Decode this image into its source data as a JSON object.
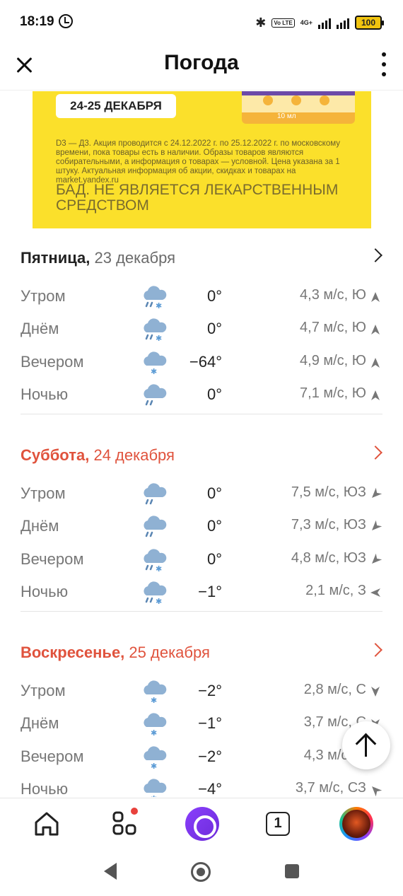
{
  "status": {
    "time": "18:19",
    "network_label": "4G+",
    "volte_label": "Vo LTE",
    "battery": "100"
  },
  "header": {
    "title": "Погода"
  },
  "ad": {
    "pill": "24-25 ДЕКАБРЯ",
    "product_volume": "10 мл",
    "disclaimer": "D3 — Д3. Акция проводится с 24.12.2022 г. по 25.12.2022 г. по московскому времени, пока товары есть в наличии. Образы товаров являются собирательными, а информация о товарах — условной. Цена указана за 1 штуку. Актуальная информация об акции, скидках и товарах на market.yandex.ru",
    "warning": "БАД. НЕ ЯВЛЯЕТСЯ ЛЕКАРСТВЕННЫМ СРЕДСТВОМ"
  },
  "days": [
    {
      "weekday": "Пятница,",
      "date": "23 декабря",
      "weekend": false,
      "rows": [
        {
          "part": "Утром",
          "icon": "cloud-rain-snow-icon",
          "temp": "0°",
          "wind": "4,3 м/с, Ю",
          "wind_dir": "S"
        },
        {
          "part": "Днём",
          "icon": "cloud-rain-snow-icon",
          "temp": "0°",
          "wind": "4,7 м/с, Ю",
          "wind_dir": "S"
        },
        {
          "part": "Вечером",
          "icon": "cloud-snow-icon",
          "temp": "−64°",
          "wind": "4,9 м/с, Ю",
          "wind_dir": "S"
        },
        {
          "part": "Ночью",
          "icon": "cloud-rain-icon",
          "temp": "0°",
          "wind": "7,1 м/с, Ю",
          "wind_dir": "S"
        }
      ]
    },
    {
      "weekday": "Суббота,",
      "date": "24 декабря",
      "weekend": true,
      "rows": [
        {
          "part": "Утром",
          "icon": "cloud-rain-icon",
          "temp": "0°",
          "wind": "7,5 м/с, ЮЗ",
          "wind_dir": "SW"
        },
        {
          "part": "Днём",
          "icon": "cloud-rain-icon",
          "temp": "0°",
          "wind": "7,3 м/с, ЮЗ",
          "wind_dir": "SW"
        },
        {
          "part": "Вечером",
          "icon": "cloud-rain-snow-icon",
          "temp": "0°",
          "wind": "4,8 м/с, ЮЗ",
          "wind_dir": "SW"
        },
        {
          "part": "Ночью",
          "icon": "cloud-rain-snow-icon",
          "temp": "−1°",
          "wind": "2,1 м/с, З",
          "wind_dir": "W"
        }
      ]
    },
    {
      "weekday": "Воскресенье,",
      "date": "25 декабря",
      "weekend": true,
      "rows": [
        {
          "part": "Утром",
          "icon": "cloud-snow-icon",
          "temp": "−2°",
          "wind": "2,8 м/с, С",
          "wind_dir": "N"
        },
        {
          "part": "Днём",
          "icon": "cloud-snow-icon",
          "temp": "−1°",
          "wind": "3,7 м/с, С",
          "wind_dir": "N"
        },
        {
          "part": "Вечером",
          "icon": "cloud-snow-icon",
          "temp": "−2°",
          "wind": "4,3 м/с, С",
          "wind_dir": "N"
        },
        {
          "part": "Ночью",
          "icon": "cloud-snow-icon",
          "temp": "−4°",
          "wind": "3,7 м/с, СЗ",
          "wind_dir": "NW"
        }
      ]
    }
  ],
  "nav": {
    "tabs_count": "1"
  },
  "colors": {
    "weekend": "#e0533d",
    "ad_bg": "#fbe02b",
    "alice": "#8a3ffc"
  }
}
